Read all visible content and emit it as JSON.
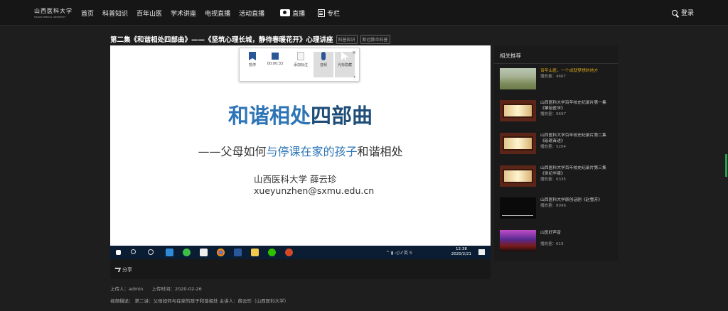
{
  "header": {
    "logo_text": "山西医科大学",
    "logo_sub": "SHANXI MEDICAL UNIVERSITY",
    "nav": [
      {
        "label": "首页",
        "icon": ""
      },
      {
        "label": "科普知识",
        "icon": ""
      },
      {
        "label": "百年山医",
        "icon": ""
      },
      {
        "label": "学术讲座",
        "icon": ""
      },
      {
        "label": "电视直播",
        "icon": ""
      },
      {
        "label": "活动直播",
        "icon": ""
      },
      {
        "label": "直播",
        "icon": "camera-icon"
      },
      {
        "label": "专栏",
        "icon": "document-icon"
      }
    ],
    "login_label": "登录"
  },
  "video": {
    "title": "第二集《和谐相处四部曲》——《坚筑心理长城，静待春暖花开》心理讲座",
    "tags": [
      "科普知识",
      "新冠肺炎科普"
    ],
    "slide": {
      "title_a": "和谐相处",
      "title_b": "四部曲",
      "sub_a": "——父母如何",
      "sub_b": "与停课在家的孩子",
      "sub_c": "和谐相处",
      "author": "山西医科大学 薛云珍",
      "email": "xueyunzhen@sxmu.edu.cn"
    },
    "recorder": {
      "pause": "暂停",
      "time": "00:00:33",
      "add": "添加标注",
      "mic": "音频",
      "cursor": "光标隐藏",
      "close": "×",
      "more": "▾"
    },
    "taskbar": {
      "time": "12:38",
      "date": "2020/2/21",
      "tray": "^  ▮  ◁)  ⁄⁄  英  S"
    },
    "share_label": "分享"
  },
  "meta": {
    "uploader": "上传人：admin",
    "upload_time": "上传时间：2020-02-26",
    "description": "视频描述：  第二讲：父母如何与在家的孩子和谐相处 主讲人：薛云珍（山西医科大学）"
  },
  "related": {
    "title": "相关推荐",
    "items": [
      {
        "title": "百年山医，一个成就梦想的地方",
        "views": "播放量：4667"
      },
      {
        "title": "山西医科大学百年校史纪录片第一集《肇始医学》",
        "views": "播放量：9697"
      },
      {
        "title": "山西医科大学百年校史纪录片第二集《砥砺奋进》",
        "views": "播放量：5204"
      },
      {
        "title": "山西医科大学百年校史纪录片第三集《世纪华章》",
        "views": "播放量：6335"
      },
      {
        "title": "山西医科大学原创话剧《赵雪芳》",
        "views": "播放量：8096"
      },
      {
        "title": "山医好声音",
        "views": "播放量：619"
      }
    ]
  },
  "colors": {
    "accent_blue": "#2e75b6",
    "dark_blue": "#1f4e79",
    "highlight_gold": "#d6a51c"
  }
}
